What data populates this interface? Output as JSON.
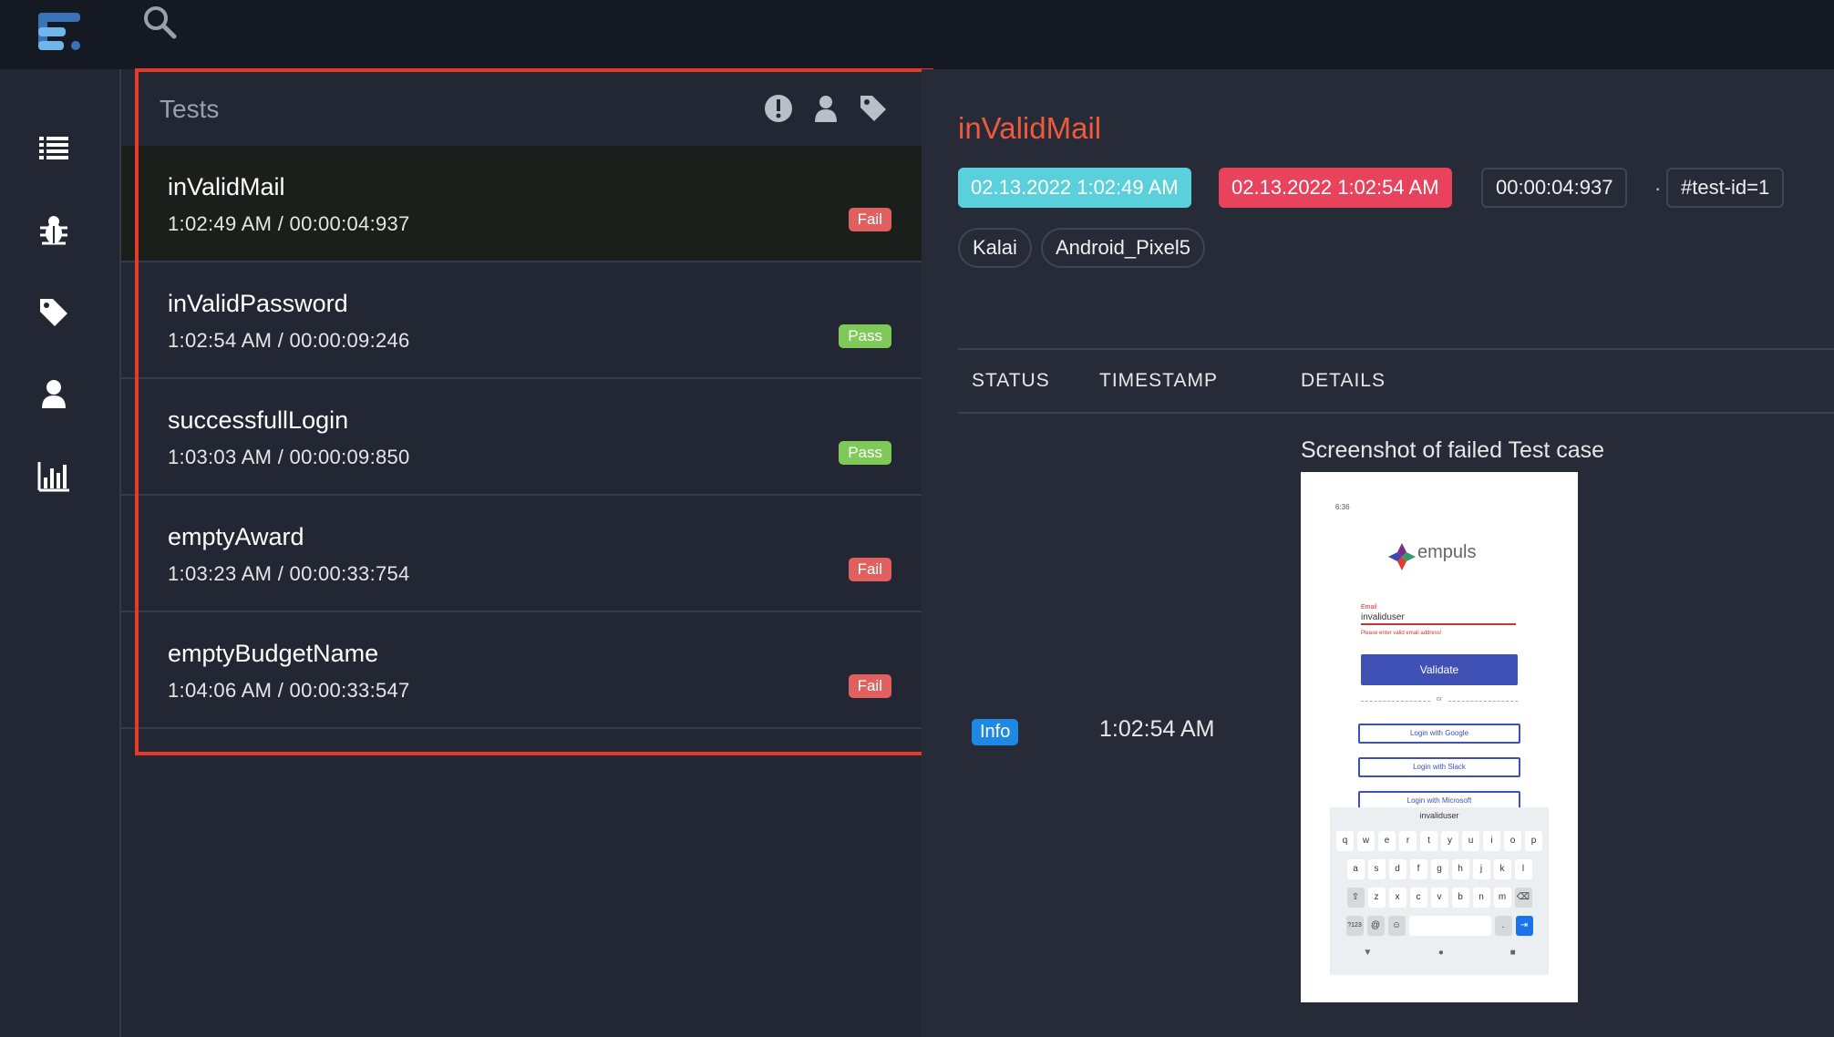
{
  "topbar": {
    "logo": "logo-icon",
    "search_icon": "search-icon"
  },
  "sidenav": {
    "items": [
      {
        "icon": "list-icon"
      },
      {
        "icon": "bug-icon"
      },
      {
        "icon": "tag-icon"
      },
      {
        "icon": "user-icon"
      },
      {
        "icon": "chart-icon"
      }
    ]
  },
  "tests": {
    "title": "Tests",
    "header_icons": [
      "exclamation-icon",
      "user-icon",
      "tag-icon"
    ],
    "items": [
      {
        "name": "inValidMail",
        "time": "1:02:49 AM / 00:00:04:937",
        "status": "Fail"
      },
      {
        "name": "inValidPassword",
        "time": "1:02:54 AM / 00:00:09:246",
        "status": "Pass"
      },
      {
        "name": "successfullLogin",
        "time": "1:03:03 AM / 00:00:09:850",
        "status": "Pass"
      },
      {
        "name": "emptyAward",
        "time": "1:03:23 AM / 00:00:33:754",
        "status": "Fail"
      },
      {
        "name": "emptyBudgetName",
        "time": "1:04:06 AM / 00:00:33:547",
        "status": "Fail"
      }
    ]
  },
  "detail": {
    "title": "inValidMail",
    "start": "02.13.2022 1:02:49 AM",
    "end": "02.13.2022 1:02:54 AM",
    "duration": "00:00:04:937",
    "separator": "·",
    "test_id": "#test-id=1",
    "tags": [
      "Kalai",
      "Android_Pixel5"
    ],
    "columns": {
      "status": "STATUS",
      "timestamp": "TIMESTAMP",
      "details": "DETAILS"
    },
    "row": {
      "status": "Info",
      "timestamp": "1:02:54 AM",
      "caption": "Screenshot of failed Test case"
    },
    "colors": {
      "title": "#ef5a3c",
      "start": "#5ad0dc",
      "end": "#e9425c",
      "fail": "#e0605f",
      "pass": "#7ec957",
      "info": "#1e88e5"
    }
  },
  "screenshot": {
    "status_time": "6:36",
    "brand": "empuls",
    "email_label": "Email",
    "email_value": "invaliduser",
    "error": "Please enter valid email address!",
    "validate": "Validate",
    "or": "or",
    "google": "Login with Google",
    "slack": "Login with Slack",
    "microsoft": "Login with Microsoft",
    "suggestion": "invaliduser",
    "kb_row1": [
      "q",
      "w",
      "e",
      "r",
      "t",
      "y",
      "u",
      "i",
      "o",
      "p"
    ],
    "kb_row2": [
      "a",
      "s",
      "d",
      "f",
      "g",
      "h",
      "j",
      "k",
      "l"
    ],
    "kb_row3": [
      "⇧",
      "z",
      "x",
      "c",
      "v",
      "b",
      "n",
      "m",
      "⌫"
    ],
    "kb_row4_left": "?123",
    "kb_row4_at": "@",
    "kb_row4_emoji": "☺",
    "kb_row4_dot": ".",
    "kb_row4_enter": "⇥",
    "nav": [
      "▼",
      "●",
      "■"
    ]
  }
}
